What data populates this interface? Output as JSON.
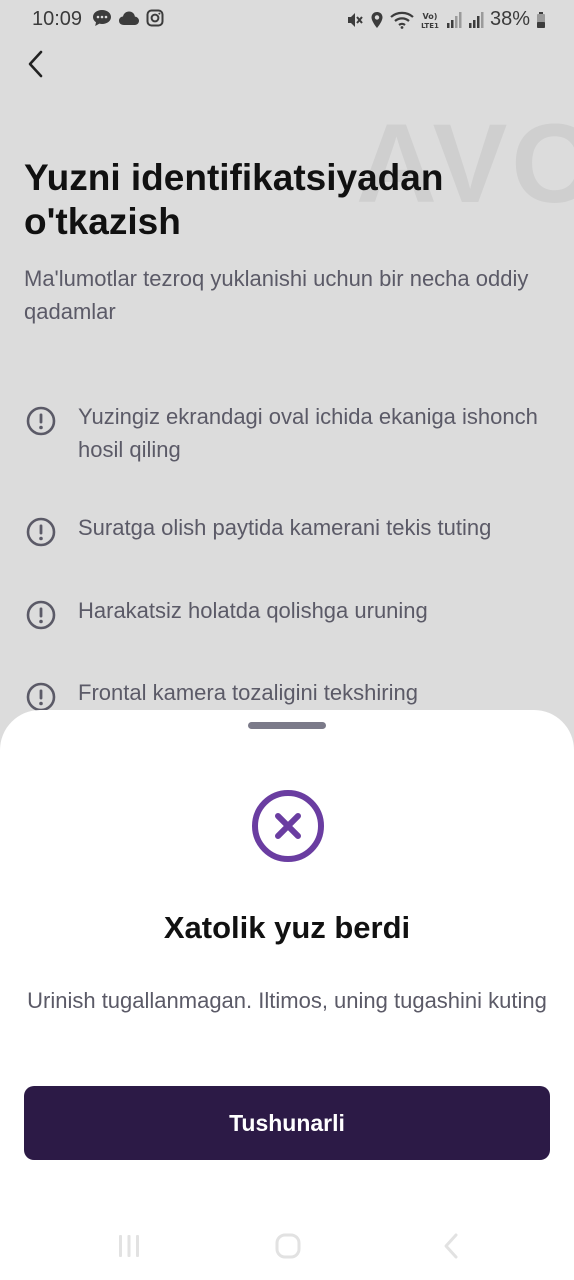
{
  "status_bar": {
    "time": "10:09",
    "battery_percent": "38%",
    "left_icons": [
      "chat-bubble-icon",
      "cloud-icon",
      "instagram-icon"
    ],
    "right_icons": [
      "mute-icon",
      "location-icon",
      "wifi-icon",
      "volte-icon",
      "signal-icon",
      "signal-icon",
      "battery-icon"
    ]
  },
  "header": {
    "back_icon": "chevron-left-icon",
    "watermark": "AVO"
  },
  "main": {
    "title": "Yuzni identifikatsiyadan o'tkazish",
    "subtitle": "Ma'lumotlar tezroq yuklanishi uchun bir necha oddiy qadamlar",
    "tips": [
      {
        "icon": "exclamation-circle-icon",
        "text": "Yuzingiz ekrandagi oval ichida ekaniga ishonch hosil qiling"
      },
      {
        "icon": "exclamation-circle-icon",
        "text": "Suratga olish paytida kamerani tekis tuting"
      },
      {
        "icon": "exclamation-circle-icon",
        "text": "Harakatsiz holatda qolishga uruning"
      },
      {
        "icon": "exclamation-circle-icon",
        "text": "Frontal kamera tozaligini tekshiring"
      }
    ]
  },
  "sheet": {
    "icon": "error-x-circle-icon",
    "title": "Xatolik yuz berdi",
    "message": "Urinish tugallanmagan. Iltimos, uning tugashini kuting",
    "button_label": "Tushunarli"
  },
  "nav_bar": {
    "icons": [
      "recent-apps-icon",
      "home-icon",
      "back-icon"
    ]
  },
  "colors": {
    "accent": "#6a3da1",
    "button_bg": "#2c1a46",
    "backdrop": "#dcdcdc",
    "text_muted": "#5b5a67"
  }
}
